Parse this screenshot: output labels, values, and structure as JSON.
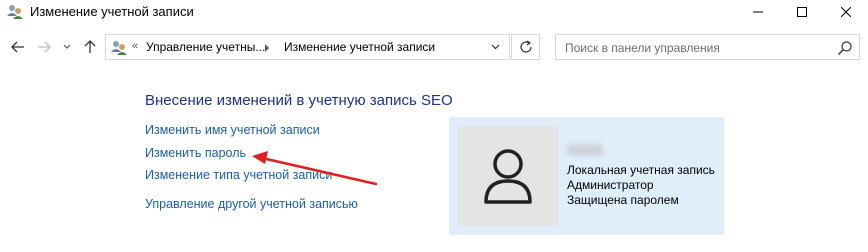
{
  "window": {
    "title": "Изменение учетной записи",
    "icon": "user-accounts-icon"
  },
  "navigation": {
    "breadcrumb_prefix": "«",
    "breadcrumbs": [
      "Управление учетны...",
      "Изменение учетной записи"
    ],
    "search_placeholder": "Поиск в панели управления"
  },
  "main": {
    "heading": "Внесение изменений в учетную запись SEO",
    "links": [
      "Изменить имя учетной записи",
      "Изменить пароль",
      "Изменение типа учетной записи",
      "Управление другой учетной записью"
    ]
  },
  "account": {
    "name": "SEO",
    "details": [
      "Локальная учетная запись",
      "Администратор",
      "Защищена паролем"
    ]
  },
  "colors": {
    "link": "#1a5fa8",
    "heading": "#1e3287",
    "panel_bg": "#dfeefa",
    "annotation_arrow": "#e02020"
  }
}
